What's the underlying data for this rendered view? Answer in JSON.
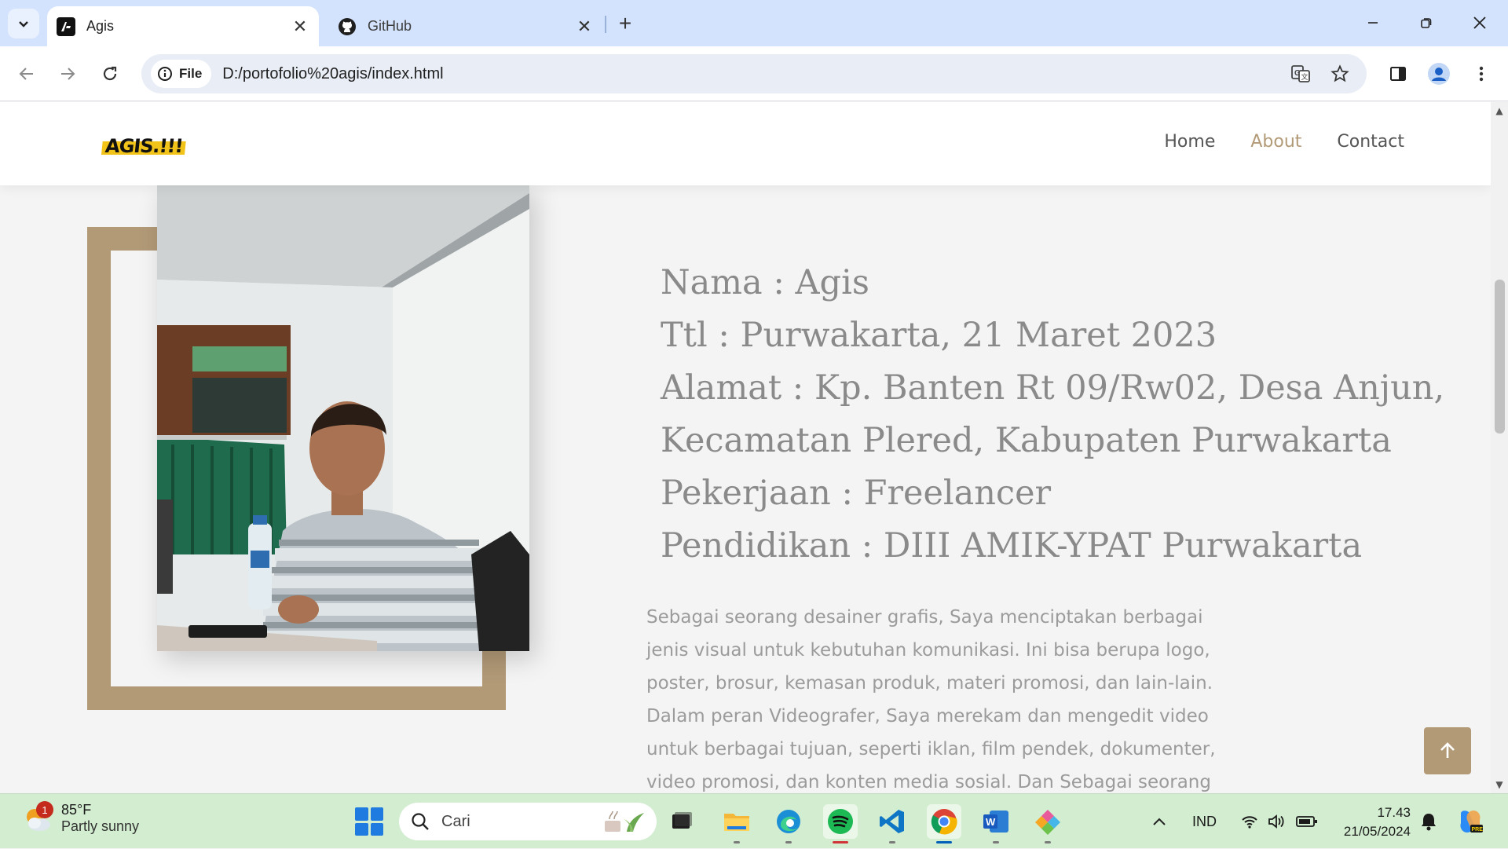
{
  "browser": {
    "tabs": [
      {
        "title": "Agis",
        "active": true,
        "favicon": "agis-logo-icon"
      },
      {
        "title": "GitHub",
        "active": false,
        "favicon": "github-icon"
      }
    ],
    "omnibox": {
      "chip_label": "File",
      "url": "D:/portofolio%20agis/index.html"
    }
  },
  "site": {
    "logo_text": "AGIS.!!!",
    "nav": [
      {
        "label": "Home",
        "active": false
      },
      {
        "label": "About",
        "active": true
      },
      {
        "label": "Contact",
        "active": false
      }
    ],
    "info_lines": [
      "Nama : Agis",
      "Ttl : Purwakarta, 21 Maret 2023",
      "Alamat : Kp. Banten Rt 09/Rw02, Desa Anjun,",
      "Kecamatan Plered, Kabupaten Purwakarta",
      "Pekerjaan : Freelancer",
      "Pendidikan : DIII AMIK-YPAT Purwakarta"
    ],
    "description_lines": [
      "Sebagai seorang desainer grafis, Saya menciptakan berbagai",
      "jenis visual untuk kebutuhan komunikasi. Ini bisa berupa logo,",
      "poster, brosur, kemasan produk, materi promosi, dan lain-lain.",
      "Dalam peran Videografer, Saya merekam dan mengedit video",
      "untuk berbagai tujuan, seperti iklan, film pendek, dokumenter,",
      "video promosi, dan konten media sosial. Dan Sebagai seorang"
    ],
    "accent_color": "#b29a77"
  },
  "taskbar": {
    "weather": {
      "temp": "85°F",
      "condition": "Partly sunny",
      "badge": "1"
    },
    "search_label": "Cari",
    "language": "IND",
    "time": "17.43",
    "date": "21/05/2024",
    "apps": [
      "task-view-icon",
      "file-explorer-icon",
      "edge-icon",
      "spotify-icon",
      "vscode-icon",
      "chrome-icon",
      "word-icon",
      "app-icon"
    ]
  }
}
